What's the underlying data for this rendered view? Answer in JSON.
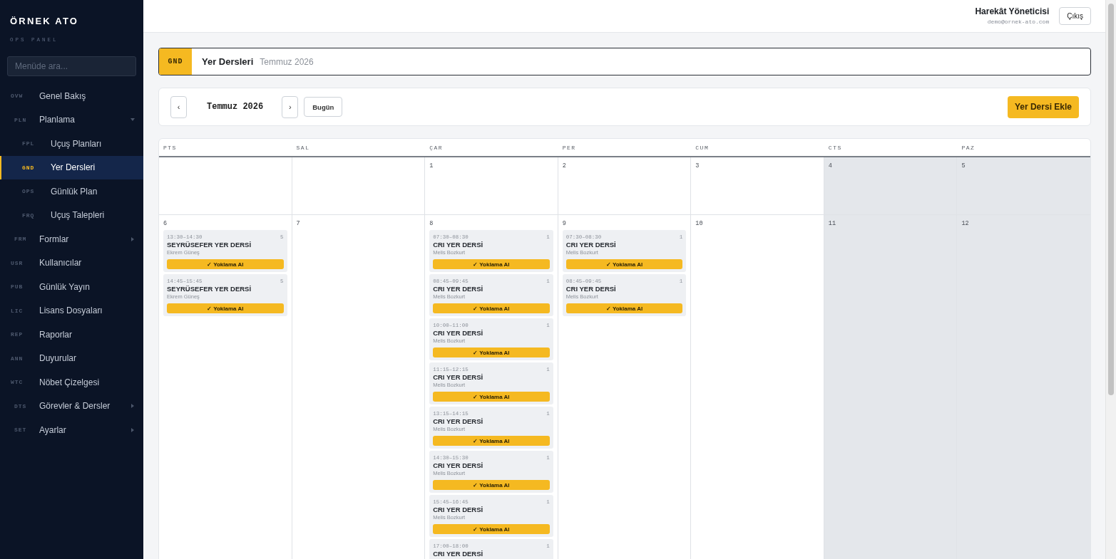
{
  "sidebar": {
    "brand": "ÖRNEK ATO",
    "subtitle": "OPS PANEL",
    "search": {
      "placeholder": "Menüde ara..."
    },
    "items": [
      {
        "kind": "link",
        "code": "OVW",
        "label": "Genel Bakış",
        "selected": false
      },
      {
        "kind": "group",
        "code": "PLN",
        "label": "Planlama",
        "selected": false,
        "expanded": true,
        "children": [
          {
            "code": "FPL",
            "label": "Uçuş Planları",
            "selected": false
          },
          {
            "code": "GND",
            "label": "Yer Dersleri",
            "selected": true
          },
          {
            "code": "OPS",
            "label": "Günlük Plan",
            "selected": false
          },
          {
            "code": "FRQ",
            "label": "Uçuş Talepleri",
            "selected": false
          }
        ]
      },
      {
        "kind": "group",
        "code": "FRM",
        "label": "Formlar",
        "selected": false,
        "expanded": false
      },
      {
        "kind": "link",
        "code": "USR",
        "label": "Kullanıcılar",
        "selected": false
      },
      {
        "kind": "link",
        "code": "PUB",
        "label": "Günlük Yayın",
        "selected": false
      },
      {
        "kind": "link",
        "code": "LIC",
        "label": "Lisans Dosyaları",
        "selected": false
      },
      {
        "kind": "link",
        "code": "REP",
        "label": "Raporlar",
        "selected": false
      },
      {
        "kind": "link",
        "code": "ANN",
        "label": "Duyurular",
        "selected": false
      },
      {
        "kind": "link",
        "code": "WTC",
        "label": "Nöbet Çizelgesi",
        "selected": false
      },
      {
        "kind": "group",
        "code": "DTS",
        "label": "Görevler & Dersler",
        "selected": false,
        "expanded": false
      },
      {
        "kind": "group",
        "code": "SET",
        "label": "Ayarlar",
        "selected": false,
        "expanded": false
      }
    ]
  },
  "header": {
    "user_name": "Harekât Yöneticisi",
    "user_email": "demo@ornek-ato.com",
    "logout": "Çıkış"
  },
  "page_title": {
    "badge": "GND",
    "title": "Yer Dersleri",
    "subtitle": "Temmuz 2026"
  },
  "toolbar": {
    "prev": "‹",
    "month": "Temmuz 2026",
    "next": "›",
    "today": "Bugün",
    "add": "Yer Dersi Ekle"
  },
  "calendar": {
    "weekdays": [
      {
        "label": "PTS",
        "weekend": false
      },
      {
        "label": "SAL",
        "weekend": false
      },
      {
        "label": "ÇAR",
        "weekend": false
      },
      {
        "label": "PER",
        "weekend": false
      },
      {
        "label": "CUM",
        "weekend": false
      },
      {
        "label": "CTS",
        "weekend": true
      },
      {
        "label": "PAZ",
        "weekend": true
      }
    ],
    "weeks": [
      [
        {
          "kind": "blank"
        },
        {
          "kind": "blank"
        },
        {
          "kind": "day",
          "day": "1"
        },
        {
          "kind": "day",
          "day": "2"
        },
        {
          "kind": "day",
          "day": "3"
        },
        {
          "kind": "day",
          "day": "4"
        },
        {
          "kind": "day",
          "day": "5"
        }
      ],
      [
        {
          "kind": "day",
          "day": "6",
          "events": [
            {
              "time": "13:30–14:30",
              "count": "5",
              "title": "SEYRÜSEFER YER DERSİ",
              "instructor": "Ekrem Güneş",
              "action": "✓ Yoklama Al"
            },
            {
              "time": "14:45–15:45",
              "count": "5",
              "title": "SEYRÜSEFER YER DERSİ",
              "instructor": "Ekrem Güneş",
              "action": "✓ Yoklama Al"
            }
          ]
        },
        {
          "kind": "day",
          "day": "7"
        },
        {
          "kind": "day",
          "day": "8",
          "events": [
            {
              "time": "07:30–08:30",
              "count": "1",
              "title": "CRI YER DERSİ",
              "instructor": "Melis Bozkurt",
              "action": "✓ Yoklama Al"
            },
            {
              "time": "08:45–09:45",
              "count": "1",
              "title": "CRI YER DERSİ",
              "instructor": "Melis Bozkurt",
              "action": "✓ Yoklama Al"
            },
            {
              "time": "10:00–11:00",
              "count": "1",
              "title": "CRI YER DERSİ",
              "instructor": "Melis Bozkurt",
              "action": "✓ Yoklama Al"
            },
            {
              "time": "11:15–12:15",
              "count": "1",
              "title": "CRI YER DERSİ",
              "instructor": "Melis Bozkurt",
              "action": "✓ Yoklama Al"
            },
            {
              "time": "13:15–14:15",
              "count": "1",
              "title": "CRI YER DERSİ",
              "instructor": "Melis Bozkurt",
              "action": "✓ Yoklama Al"
            },
            {
              "time": "14:30–15:30",
              "count": "1",
              "title": "CRI YER DERSİ",
              "instructor": "Melis Bozkurt",
              "action": "✓ Yoklama Al"
            },
            {
              "time": "15:45–16:45",
              "count": "1",
              "title": "CRI YER DERSİ",
              "instructor": "Melis Bozkurt",
              "action": "✓ Yoklama Al"
            },
            {
              "time": "17:00–18:00",
              "count": "1",
              "title": "CRI YER DERSİ"
            }
          ]
        },
        {
          "kind": "day",
          "day": "9",
          "events": [
            {
              "time": "07:30–08:30",
              "count": "1",
              "title": "CRI YER DERSİ",
              "instructor": "Melis Bozkurt",
              "action": "✓ Yoklama Al"
            },
            {
              "time": "08:45–09:45",
              "count": "1",
              "title": "CRI YER DERSİ",
              "instructor": "Melis Bozkurt",
              "action": "✓ Yoklama Al"
            }
          ]
        },
        {
          "kind": "day",
          "day": "10"
        },
        {
          "kind": "day",
          "day": "11"
        },
        {
          "kind": "day",
          "day": "12"
        }
      ]
    ]
  }
}
